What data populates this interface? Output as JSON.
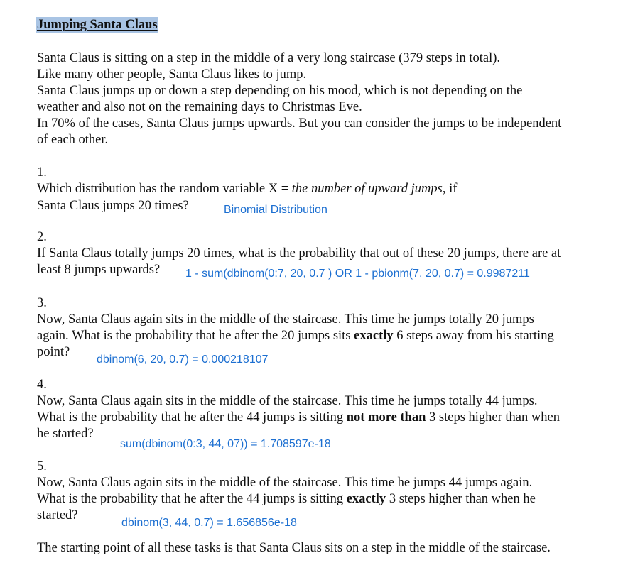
{
  "title": "Jumping Santa Claus",
  "intro": [
    "Santa Claus is sitting on a step in the middle of a very long staircase (379 steps in total).",
    "Like many other people, Santa Claus likes to jump.",
    "Santa Claus jumps up or down a step depending on his mood, which is not depending on the",
    "weather and also not on the remaining days to Christmas Eve.",
    "In 70% of the cases, Santa Claus jumps upwards. But you can consider the jumps to be independent",
    "of each other."
  ],
  "q1": {
    "number": "1.",
    "pre": "Which distribution has the random variable X = ",
    "italic": "the number of upward jumps",
    "post": ", if",
    "line2": "Santa Claus jumps 20 times?",
    "answer": "Binomial Distribution"
  },
  "q2": {
    "number": "2.",
    "line1": "If Santa Claus totally jumps 20 times, what is the probability that out of these 20 jumps, there are at",
    "line2": "least 8 jumps upwards?",
    "answer": "1 - sum(dbinom(0:7, 20, 0.7 ) OR 1 - pbionm(7, 20, 0.7)  = 0.9987211"
  },
  "q3": {
    "number": "3.",
    "line1": "Now, Santa Claus again sits in the middle of the staircase. This time he jumps totally 20 jumps",
    "line2_pre": "again. What is the probability that he after the 20 jumps sits ",
    "line2_bold": "exactly",
    "line2_post": " 6 steps away from his starting",
    "line3": "point?",
    "answer": "dbinom(6, 20, 0.7) = 0.000218107"
  },
  "q4": {
    "number": "4.",
    "line1": "Now, Santa Claus again sits in the middle of the staircase. This time he jumps totally 44 jumps.",
    "line2_pre": "What is the probability that he after the 44 jumps is sitting ",
    "line2_bold": "not more than",
    "line2_post": " 3 steps higher than when",
    "line3": "he started?",
    "answer": "sum(dbinom(0:3, 44, 07)) = 1.708597e-18"
  },
  "q5": {
    "number": "5.",
    "line1": "Now, Santa Claus again sits in the middle of the staircase. This time he jumps 44 jumps again.",
    "line2_pre": "What is the probability that he after the 44 jumps is sitting ",
    "line2_bold": "exactly",
    "line2_post": " 3 steps higher than when he",
    "line3": "started?",
    "answer": "dbinom(3, 44, 0.7) = 1.656856e-18"
  },
  "footer": "The starting point of all these tasks is that Santa Claus sits on a step in the middle of the staircase."
}
